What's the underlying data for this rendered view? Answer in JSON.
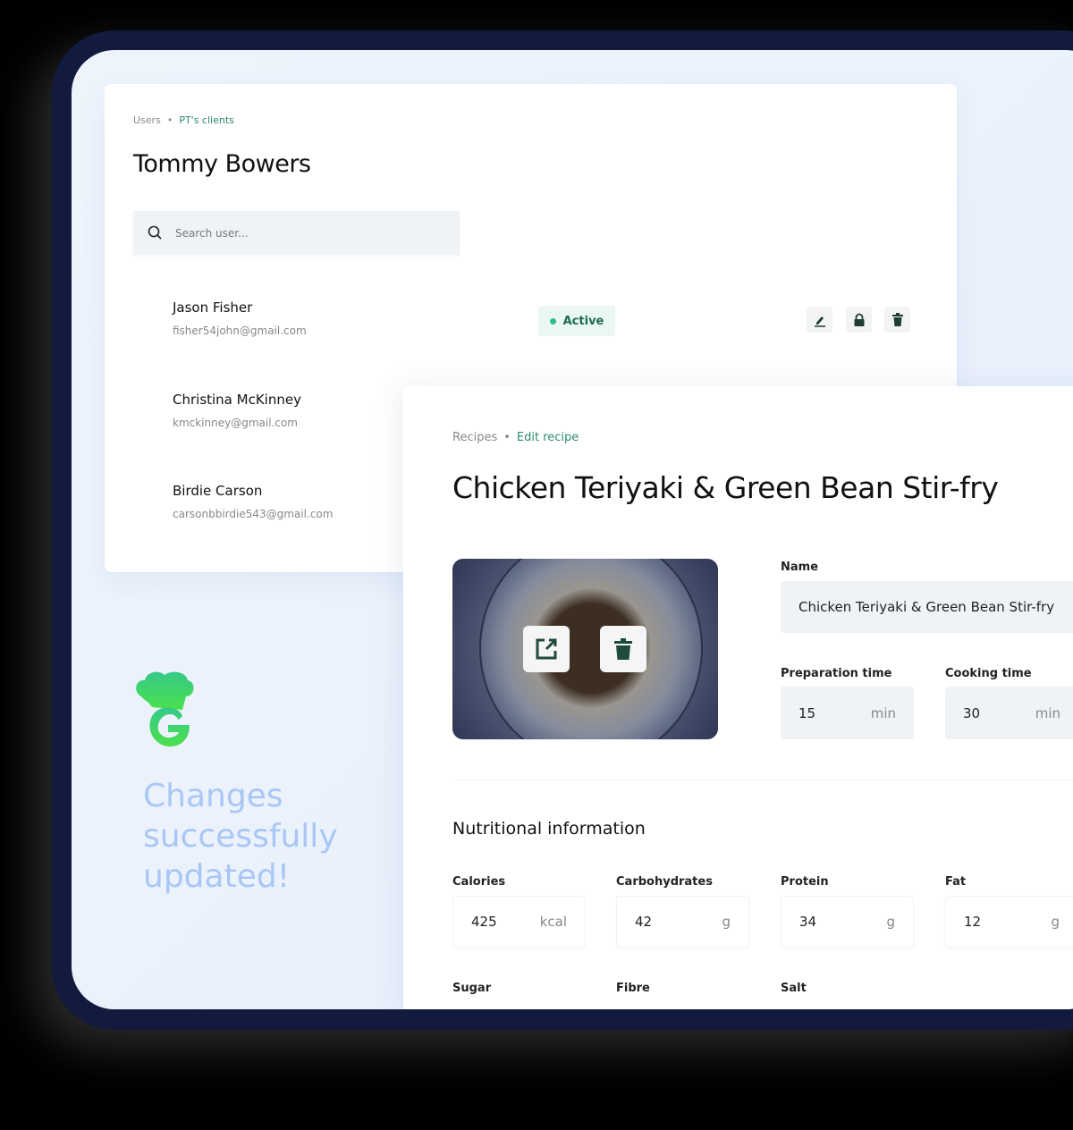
{
  "users_page": {
    "breadcrumb": [
      "Users",
      "PT's clients"
    ],
    "title": "Tommy Bowers",
    "search_placeholder": "Search user...",
    "users": [
      {
        "name": "Jason Fisher",
        "email": "fisher54john@gmail.com",
        "status": "Active"
      },
      {
        "name": "Christina McKinney",
        "email": "kmckinney@gmail.com"
      },
      {
        "name": "Birdie Carson",
        "email": "carsonbbirdie543@gmail.com"
      }
    ],
    "actions": [
      "edit-icon",
      "lock-icon",
      "trash-icon"
    ]
  },
  "toast": {
    "message": "Changes successfully updated!"
  },
  "recipe_page": {
    "breadcrumb": [
      "Recipes",
      "Edit recipe"
    ],
    "title": "Chicken Teriyaki & Green Bean Stir-fry",
    "image_actions": [
      "open-external-icon",
      "trash-icon"
    ],
    "name_label": "Name",
    "name_value": "Chicken Teriyaki & Green Bean Stir-fry",
    "prep_label": "Preparation time",
    "prep_value": "15",
    "prep_unit": "min",
    "cook_label": "Cooking time",
    "cook_value": "30",
    "cook_unit": "min",
    "nutrition_title": "Nutritional information",
    "nutrition": [
      {
        "label": "Calories",
        "value": "425",
        "unit": "kcal"
      },
      {
        "label": "Carbohydrates",
        "value": "42",
        "unit": "g"
      },
      {
        "label": "Protein",
        "value": "34",
        "unit": "g"
      },
      {
        "label": "Fat",
        "value": "12",
        "unit": "g"
      }
    ],
    "nutrition_more": [
      "Sugar",
      "Fibre",
      "Salt"
    ]
  },
  "colors": {
    "accent": "#2e8a66",
    "frame": "#121a3e",
    "success_text": "#a9c6f5",
    "logo": "#3ddc84"
  }
}
